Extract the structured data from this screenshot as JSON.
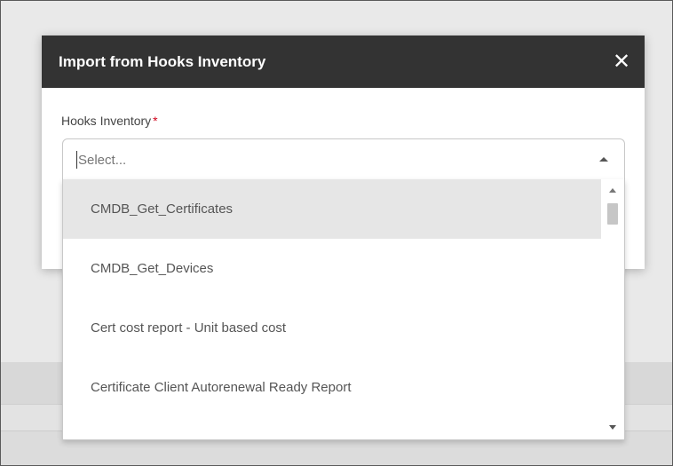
{
  "modal": {
    "title": "Import from Hooks Inventory",
    "close_icon": "close-icon",
    "field_label": "Hooks Inventory",
    "required_marker": "*"
  },
  "select": {
    "placeholder": "Select...",
    "value": "",
    "arrow_icon": "chevron-up-icon"
  },
  "dropdown": {
    "options": [
      {
        "label": "CMDB_Get_Certificates",
        "highlighted": true
      },
      {
        "label": "CMDB_Get_Devices",
        "highlighted": false
      },
      {
        "label": "Cert cost report - Unit based cost",
        "highlighted": false
      },
      {
        "label": "Certificate Client Autorenewal Ready Report",
        "highlighted": false
      }
    ]
  },
  "colors": {
    "header_bg": "#333333",
    "required": "#d0021b",
    "highlight": "#e6e6e6"
  }
}
